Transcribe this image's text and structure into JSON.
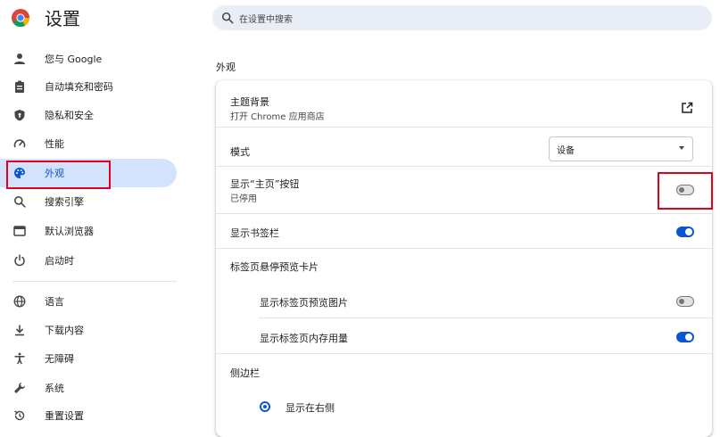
{
  "header": {
    "title": "设置",
    "search_placeholder": "在设置中搜索"
  },
  "sidebar": {
    "items": [
      {
        "label": "您与 Google",
        "icon": "person-icon"
      },
      {
        "label": "自动填充和密码",
        "icon": "clipboard-icon"
      },
      {
        "label": "隐私和安全",
        "icon": "shield-icon"
      },
      {
        "label": "性能",
        "icon": "speedometer-icon"
      },
      {
        "label": "外观",
        "icon": "palette-icon",
        "active": true
      },
      {
        "label": "搜索引擎",
        "icon": "search-icon"
      },
      {
        "label": "默认浏览器",
        "icon": "browser-window-icon"
      },
      {
        "label": "启动时",
        "icon": "power-icon"
      },
      {
        "label": "语言",
        "icon": "globe-icon"
      },
      {
        "label": "下载内容",
        "icon": "download-icon"
      },
      {
        "label": "无障碍",
        "icon": "accessibility-icon"
      },
      {
        "label": "系统",
        "icon": "wrench-icon"
      },
      {
        "label": "重置设置",
        "icon": "reset-icon"
      }
    ]
  },
  "main": {
    "section_title": "外观",
    "theme": {
      "label": "主题背景",
      "sub": "打开 Chrome 应用商店"
    },
    "mode": {
      "label": "模式",
      "value": "设备"
    },
    "home_button": {
      "label": "显示“主页”按钮",
      "sub": "已停用",
      "on": false
    },
    "bookmarks_bar": {
      "label": "显示书签栏",
      "on": true
    },
    "hover_card": {
      "label": "标签页悬停预览卡片",
      "preview_image": {
        "label": "显示标签页预览图片",
        "on": false
      },
      "memory_usage": {
        "label": "显示标签页内存用量",
        "on": true
      }
    },
    "side_panel": {
      "label": "侧边栏",
      "option_right": "显示在右侧"
    }
  },
  "colors": {
    "accent": "#0b57d0",
    "active_nav_bg": "#d3e3fd",
    "highlight_box": "#e3001b"
  }
}
